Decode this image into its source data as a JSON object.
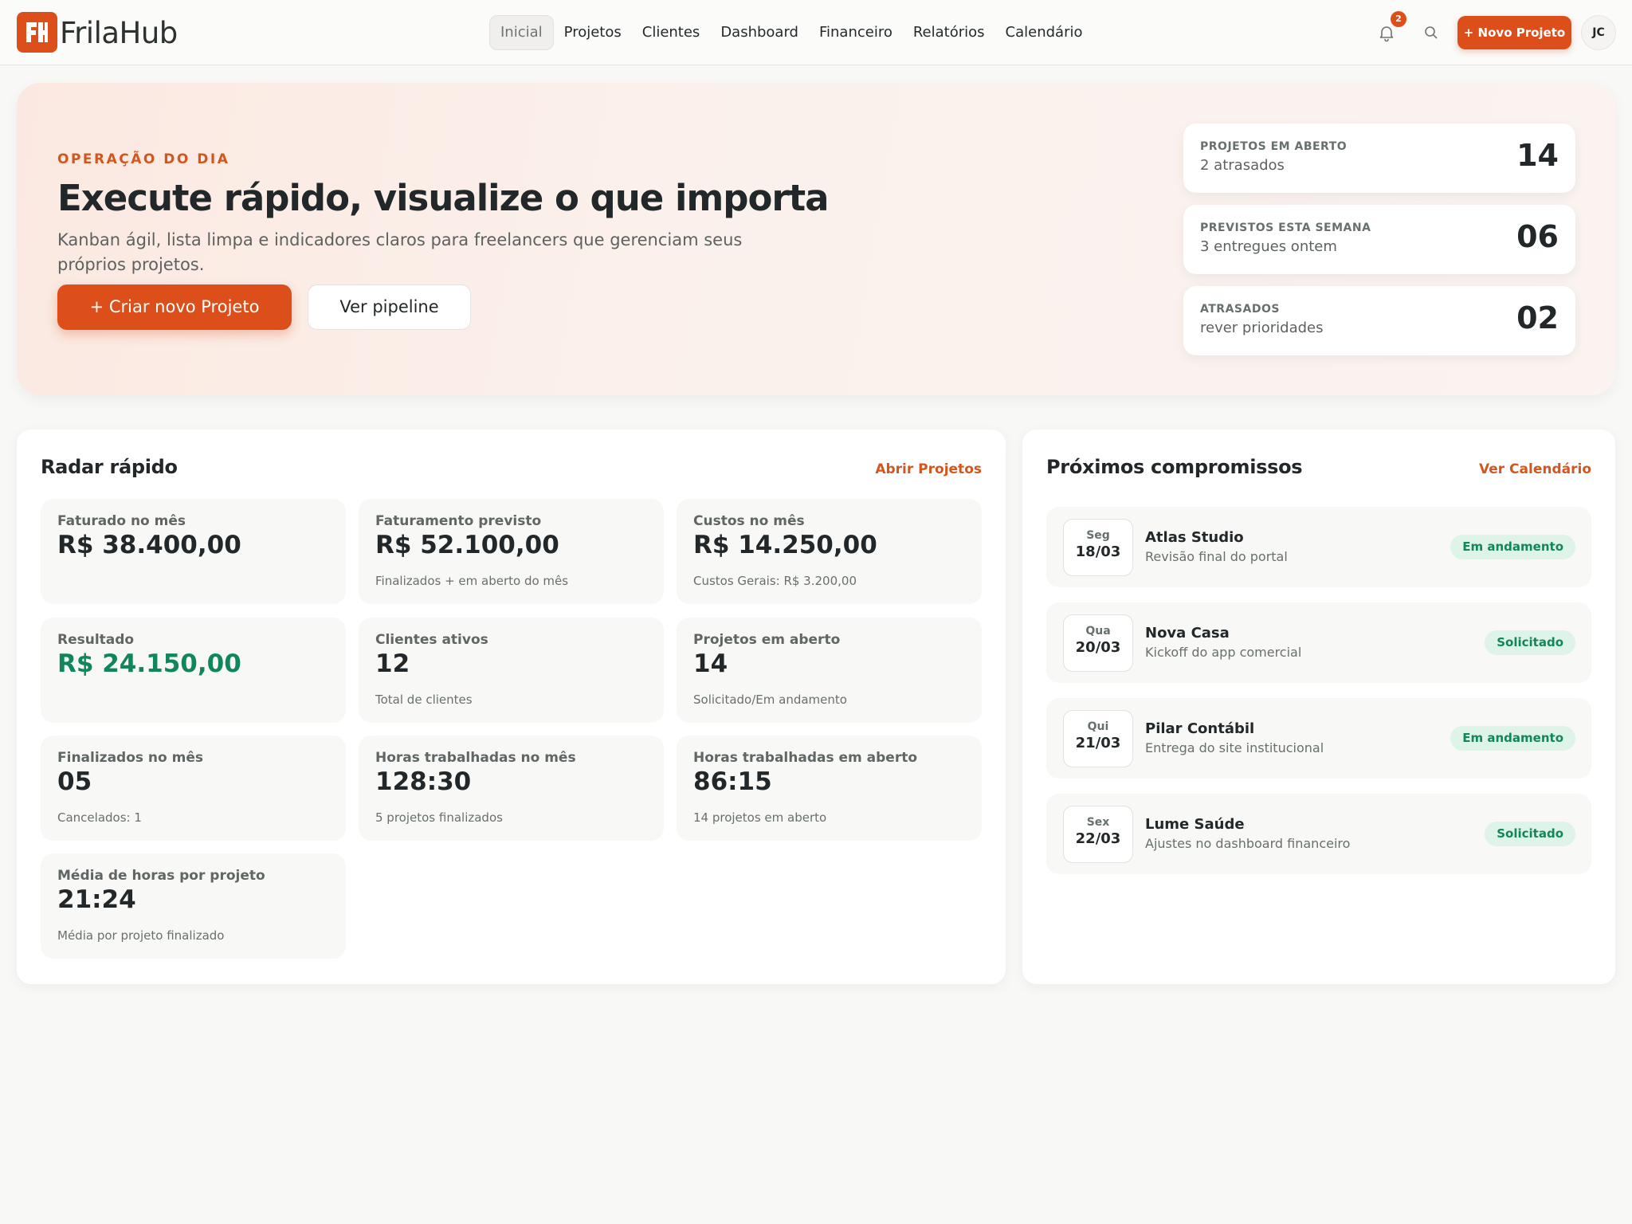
{
  "brand": {
    "name": "FrilaHub",
    "accent": "#dc4f1b"
  },
  "nav": {
    "items": [
      {
        "label": "Inicial",
        "active": true
      },
      {
        "label": "Projetos"
      },
      {
        "label": "Clientes"
      },
      {
        "label": "Dashboard"
      },
      {
        "label": "Financeiro"
      },
      {
        "label": "Relatórios"
      },
      {
        "label": "Calendário"
      }
    ],
    "notifications_count": "2",
    "new_project_label": "+ Novo Projeto",
    "avatar_initials": "JC",
    "icons": [
      "bell-icon",
      "search-icon"
    ]
  },
  "hero": {
    "kicker": "OPERAÇÃO DO DIA",
    "title": "Execute rápido, visualize o que importa",
    "subtitle": "Kanban ágil, lista limpa e indicadores claros para freelancers que gerenciam seus próprios projetos.",
    "primary_button": "+ Criar novo Projeto",
    "secondary_button": "Ver pipeline",
    "stats": [
      {
        "label": "PROJETOS EM ABERTO",
        "note": "2 atrasados",
        "value": "14"
      },
      {
        "label": "PREVISTOS ESTA SEMANA",
        "note": "3 entregues ontem",
        "value": "06"
      },
      {
        "label": "ATRASADOS",
        "note": "rever prioridades",
        "value": "02"
      }
    ]
  },
  "radar": {
    "title": "Radar rápido",
    "link": "Abrir Projetos",
    "metrics": [
      {
        "label": "Faturado no mês",
        "value": "R$ 38.400,00",
        "note": ""
      },
      {
        "label": "Faturamento previsto",
        "value": "R$ 52.100,00",
        "note": "Finalizados + em aberto do mês"
      },
      {
        "label": "Custos no mês",
        "value": "R$ 14.250,00",
        "note": "Custos Gerais: R$ 3.200,00"
      },
      {
        "label": "Resultado",
        "value": "R$ 24.150,00",
        "note": "",
        "positive": true
      },
      {
        "label": "Clientes ativos",
        "value": "12",
        "note": "Total de clientes"
      },
      {
        "label": "Projetos em aberto",
        "value": "14",
        "note": "Solicitado/Em andamento"
      },
      {
        "label": "Finalizados no mês",
        "value": "05",
        "note": "Cancelados: 1"
      },
      {
        "label": "Horas trabalhadas no mês",
        "value": "128:30",
        "note": "5 projetos finalizados"
      },
      {
        "label": "Horas trabalhadas em aberto",
        "value": "86:15",
        "note": "14 projetos em aberto"
      },
      {
        "label": "Média de horas por projeto",
        "value": "21:24",
        "note": "Média por projeto finalizado"
      }
    ]
  },
  "agenda": {
    "title": "Próximos compromissos",
    "link": "Ver Calendário",
    "items": [
      {
        "dow": "Seg",
        "day": "18/03",
        "client": "Atlas Studio",
        "desc": "Revisão final do portal",
        "status": "Em andamento"
      },
      {
        "dow": "Qua",
        "day": "20/03",
        "client": "Nova Casa",
        "desc": "Kickoff do app comercial",
        "status": "Solicitado"
      },
      {
        "dow": "Qui",
        "day": "21/03",
        "client": "Pilar Contábil",
        "desc": "Entrega do site institucional",
        "status": "Em andamento"
      },
      {
        "dow": "Sex",
        "day": "22/03",
        "client": "Lume Saúde",
        "desc": "Ajustes no dashboard financeiro",
        "status": "Solicitado"
      }
    ]
  }
}
